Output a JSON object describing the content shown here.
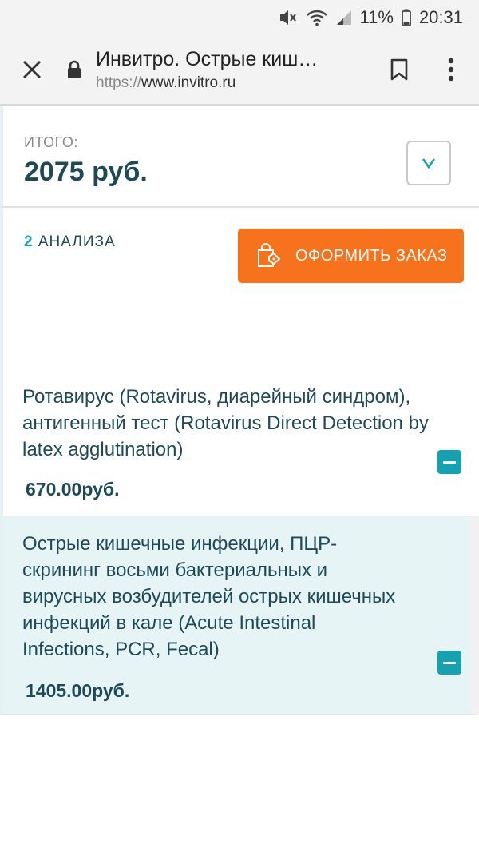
{
  "status_bar": {
    "battery_percent": "11%",
    "time": "20:31",
    "icons": [
      "mute-icon",
      "wifi-icon",
      "signal-icon",
      "battery-icon"
    ]
  },
  "browser": {
    "title": "Инвитро. Острые киш…",
    "url_scheme": "https://",
    "url_host": "www.invitro.ru"
  },
  "summary": {
    "total_label": "ИТОГО:",
    "total_amount": "2075 руб."
  },
  "order": {
    "count_number": "2",
    "count_text": "АНАЛИЗА",
    "button_label": "ОФОРМИТЬ ЗАКАЗ"
  },
  "items": [
    {
      "name": "Ротавирус (Rotavirus, диарейный синдром), антигенный тест (Rotavirus Direct Detection by latex agglutination)",
      "price": "670.00руб."
    },
    {
      "name": "Острые кишечные инфекции, ПЦР-скрининг восьми бактериальных и вирусных возбудителей острых кишечных инфекций в кале (Acute Intestinal Infections, PCR, Fecal)",
      "price": "1405.00руб."
    }
  ],
  "colors": {
    "accent_orange": "#f7721d",
    "accent_teal": "#16a1b0",
    "text_dark": "#1e4a57",
    "highlight_bg": "#e6f4f6"
  }
}
